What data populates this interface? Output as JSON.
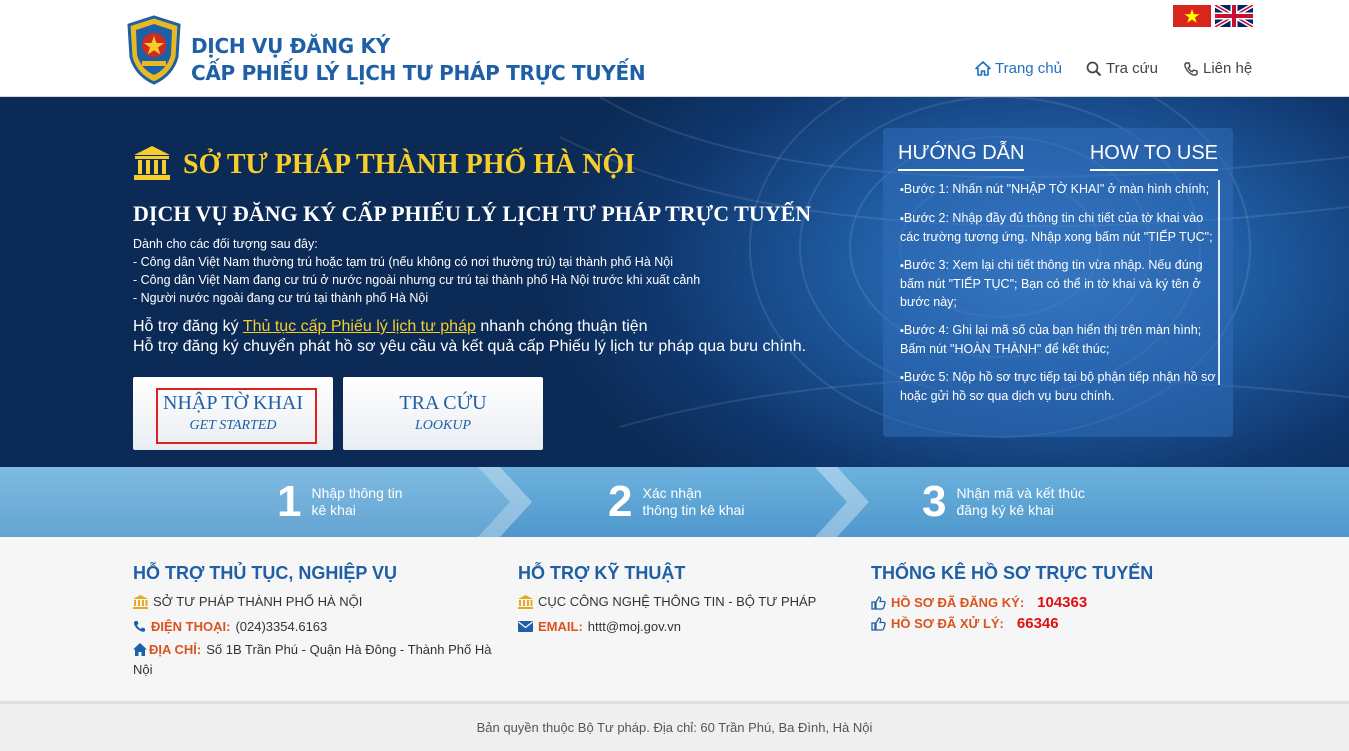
{
  "header": {
    "title_line1": "DỊCH VỤ ĐĂNG KÝ",
    "title_line2": "CẤP PHIẾU LÝ LỊCH TƯ PHÁP TRỰC TUYẾN",
    "nav": {
      "home": "Trang chủ",
      "search": "Tra cứu",
      "contact": "Liên hệ"
    },
    "flags": [
      "vietnam-flag-icon",
      "uk-flag-icon"
    ]
  },
  "hero": {
    "dept_title": "SỞ TƯ PHÁP THÀNH PHỐ HÀ NỘI",
    "service_title": "DỊCH VỤ ĐĂNG KÝ CẤP PHIẾU LÝ LỊCH TƯ PHÁP TRỰC TUYẾN",
    "audience_intro": "Dành cho các đối tượng sau đây:",
    "audience": [
      "- Công dân Việt Nam thường trú hoặc tạm trú (nếu không có nơi thường trú) tại thành phố Hà Nội",
      "- Công dân Việt Nam đang cư trú ở nước ngoài nhưng cư trú tại thành phố Hà Nội trước khi xuất cảnh",
      "- Người nước ngoài đang cư trú tại thành phố Hà Nội"
    ],
    "support_prefix": "Hỗ trợ đăng ký ",
    "support_link": "Thủ tục cấp Phiếu lý lịch tư pháp",
    "support_suffix": " nhanh chóng thuận tiện",
    "support_line2": "Hỗ trợ đăng ký chuyển phát hồ sơ yêu cầu và kết quả cấp Phiếu lý lịch tư pháp qua bưu chính.",
    "btn_start_main": "NHẬP TỜ KHAI",
    "btn_start_sub": "GET STARTED",
    "btn_lookup_main": "TRA CỨU",
    "btn_lookup_sub": "LOOKUP"
  },
  "guide": {
    "title_vi": "HƯỚNG DẪN",
    "title_en": "HOW TO USE",
    "steps": [
      "Bước 1: Nhấn nút \"NHẬP TỜ KHAI\" ở màn hình chính;",
      "Bước 2: Nhập đầy đủ thông tin chi tiết của tờ khai vào các trường tương ứng. Nhập xong bấm nút \"TIẾP TỤC\";",
      "Bước 3: Xem lại chi tiết thông tin vừa nhập. Nếu đúng bấm nút \"TIẾP TỤC\"; Bạn có thể in tờ khai và ký tên ở bước này;",
      "Bước 4: Ghi lại mã số của bạn hiển thị trên màn hình; Bấm nút \"HOÀN THÀNH\" để kết thúc;",
      "Bước 5: Nộp hồ sơ trực tiếp tại bộ phận tiếp nhận hồ sơ hoặc gửi hồ sơ qua dịch vụ bưu chính."
    ]
  },
  "process": [
    {
      "num": "1",
      "line1": "Nhập thông tin",
      "line2": "kê khai"
    },
    {
      "num": "2",
      "line1": "Xác nhận",
      "line2": "thông tin kê khai"
    },
    {
      "num": "3",
      "line1": "Nhận mã và kết thúc",
      "line2": "đăng ký kê khai"
    }
  ],
  "support_proc": {
    "title": "HỖ TRỢ THỦ TỤC, NGHIỆP VỤ",
    "org": "SỞ TƯ PHÁP THÀNH PHỐ HÀ NỘI",
    "phone_label": "ĐIỆN THOẠI:",
    "phone": "(024)3354.6163",
    "addr_label": "ĐỊA CHỈ:",
    "addr": "Số 1B Trần Phú - Quận Hà Đông - Thành Phố Hà Nội"
  },
  "support_tech": {
    "title": "HỖ TRỢ KỸ THUẬT",
    "org": "CỤC CÔNG NGHỆ THÔNG TIN - BỘ TƯ PHÁP",
    "email_label": "EMAIL:",
    "email": "httt@moj.gov.vn"
  },
  "stats": {
    "title": "THỐNG KÊ HỒ SƠ TRỰC TUYẾN",
    "registered_label": "HỒ SƠ ĐÃ ĐĂNG KÝ:",
    "registered": "104363",
    "processed_label": "HỒ SƠ ĐÃ XỬ LÝ:",
    "processed": "66346"
  },
  "footer": {
    "text": "Bản quyền thuộc Bộ Tư pháp. Địa chỉ: 60 Trần Phú, Ba Đình, Hà Nội"
  },
  "colors": {
    "brand_blue": "#1f5fa6",
    "gold": "#f6cd2a",
    "label_orange": "#d9531e",
    "stat_red": "#e01010"
  }
}
